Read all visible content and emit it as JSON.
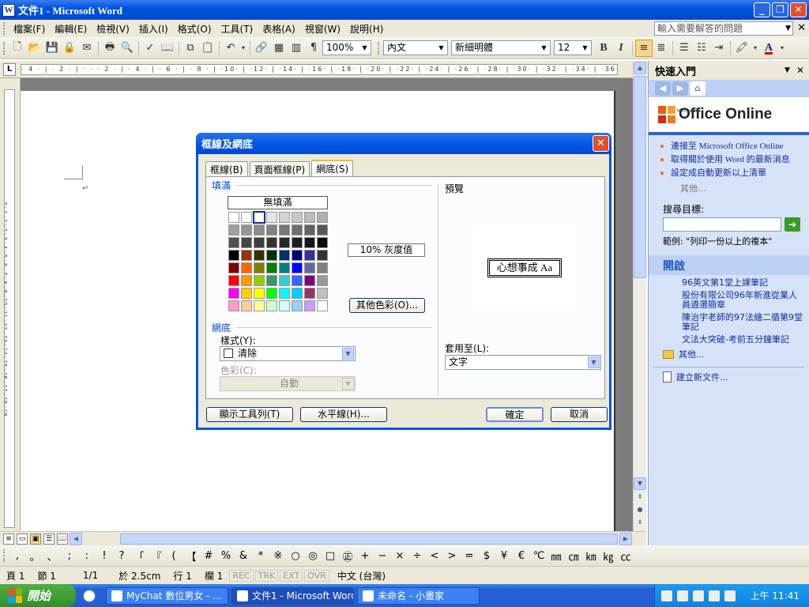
{
  "window": {
    "title": "文件1 - Microsoft Word",
    "icon": "word-doc-icon"
  },
  "menubar": {
    "items": [
      "檔案(F)",
      "編輯(E)",
      "檢視(V)",
      "插入(I)",
      "格式(O)",
      "工具(T)",
      "表格(A)",
      "視窗(W)",
      "說明(H)"
    ],
    "ask_placeholder": "輸入需要解答的問題"
  },
  "toolbar": {
    "zoom": "100%",
    "style": "內文",
    "font": "新細明體",
    "size": "12",
    "bold": "B",
    "italic": "I",
    "font_color": "A"
  },
  "ruler": {
    "marks": "· 4 · | · 2 · | · · · 2 · | · 4 · | · 6 · | · 8 · | ·10· | ·12· | ·14· | ·16· | ·18· | ·20· | ·22· | ·24· | ·26· | ·28· | ·30· | ·32· | ·34· | ·36· | ·38· | ·40· | ·42·"
  },
  "vruler": {
    "marks": "2 · 1 · 1 · 2 · 3 · 4 · 5 · 6 · 7 · 8 · 9 · 10 · 11 · 12 · 13 · 14 · 15 · 16 · 17 · 18 · 19"
  },
  "dialog": {
    "title": "框線及網底",
    "tabs": [
      "框線(B)",
      "頁面框線(P)",
      "網底(S)"
    ],
    "active_tab": 2,
    "fill_label": "填滿",
    "no_fill": "無填滿",
    "selected_fill": "10% 灰度值",
    "more_colors": "其他色彩(O)...",
    "pattern_label": "網底",
    "style_label": "樣式(Y):",
    "style_value": "清除",
    "color_label": "色彩(C):",
    "color_value": "自動",
    "preview_label": "預覽",
    "preview_text": "心想事成 Aa",
    "apply_to_label": "套用至(L):",
    "apply_to_value": "文字",
    "btn_toolbar": "顯示工具列(T)",
    "btn_hline": "水平線(H)...",
    "btn_ok": "確定",
    "btn_cancel": "取消",
    "palette": [
      "#ffffff",
      "#ffffff",
      "#ffffff",
      "#e6e6e6",
      "#d4d4d4",
      "#c8c8c8",
      "#bcbcbc",
      "#b0b0b0",
      "#a0a0a0",
      "#969696",
      "#8c8c8c",
      "#828282",
      "#787878",
      "#6e6e6e",
      "#646464",
      "#5a5a5a",
      "#505050",
      "#464646",
      "#3c3c3c",
      "#333333",
      "#282828",
      "#1e1e1e",
      "#141414",
      "#0a0a0a",
      "#000000",
      "#993300",
      "#333300",
      "#003300",
      "#003366",
      "#000080",
      "#333399",
      "#333333",
      "#800000",
      "#ff6600",
      "#808000",
      "#008000",
      "#008080",
      "#0000ff",
      "#666699",
      "#808080",
      "#ff0000",
      "#ff9900",
      "#99cc00",
      "#339966",
      "#33cccc",
      "#3366ff",
      "#800080",
      "#999999",
      "#ff00ff",
      "#ffcc00",
      "#ffff00",
      "#00ff00",
      "#00ffff",
      "#00ccff",
      "#993366",
      "#c0c0c0",
      "#ff99cc",
      "#ffcc99",
      "#ffff99",
      "#ccffcc",
      "#ccffff",
      "#99ccff",
      "#cc99ff",
      "#ffffff"
    ],
    "palette_selected_index": 2
  },
  "taskpane": {
    "title": "快速入門",
    "logo_sub": "Microsoft",
    "logo_text": "Office Online",
    "links": [
      "連接至 Microsoft Office Online",
      "取得關於使用 Word 的最新消息",
      "設定成自動更新以上清單"
    ],
    "more": "其他...",
    "search_label": "搜尋目標:",
    "example": "範例: \"列印一份以上的複本\"",
    "open_section": "開啟",
    "docs": [
      "96英文第1堂上課筆記",
      "股份有限公司96年新進從業人員遴選簡章",
      "陳治宇老師的97法繪二循第9堂筆記",
      "文法大突破-考前五分鐘筆記"
    ],
    "open_more": "其他...",
    "new_doc": "建立新文件..."
  },
  "symbols": [
    ",",
    "。",
    "、",
    ";",
    ":",
    "!",
    "?",
    "「",
    "『",
    "(",
    "【",
    "#",
    "%",
    "&",
    "*",
    "※",
    "○",
    "◎",
    "□",
    "㊣",
    "+",
    "−",
    "×",
    "÷",
    "<",
    ">",
    "=",
    "$",
    "¥",
    "€",
    "℃",
    "㎜",
    "㎝",
    "㎞",
    "㎏",
    "㏄"
  ],
  "status": {
    "page": "頁 1",
    "section": "節 1",
    "pages": "1/1",
    "at": "於 2.5cm",
    "line": "行 1",
    "col": "欄 1",
    "rec": "REC",
    "trk": "TRK",
    "ext": "EXT",
    "ovr": "OVR",
    "lang": "中文 (台灣)"
  },
  "taskbar": {
    "start": "開始",
    "tasks": [
      "MyChat 數位男女 - ...",
      "文件1 - Microsoft Word",
      "未命名 - 小畫家"
    ],
    "active_task": 1,
    "clock": "上午 11:41"
  }
}
